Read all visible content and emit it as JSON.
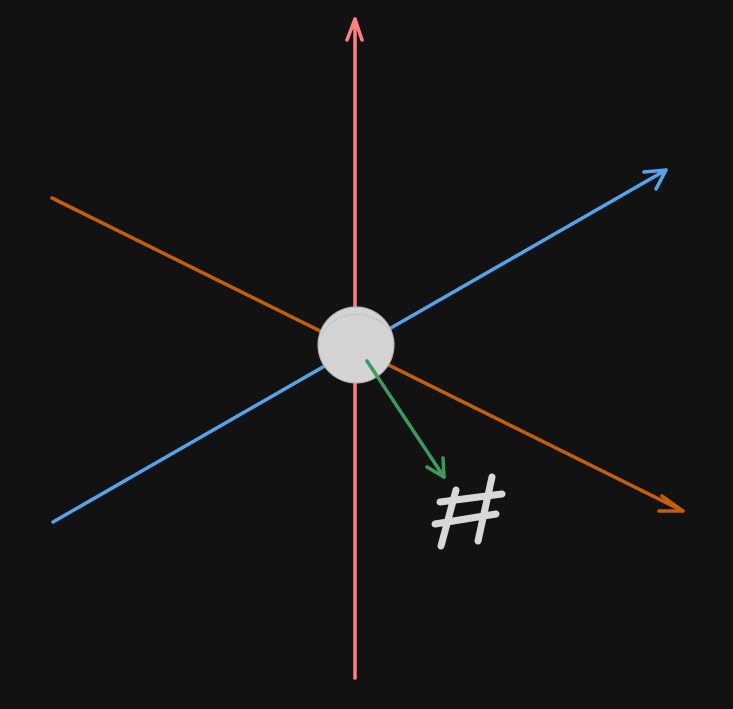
{
  "diagram": {
    "background_color": "#121212",
    "axes": [
      {
        "name": "vertical-axis",
        "color": "#ff8080",
        "has_arrowhead": true
      },
      {
        "name": "diagonal-axis-up-right",
        "color": "#55a3eb",
        "has_arrowhead": true
      },
      {
        "name": "diagonal-axis-down-right",
        "color": "#c45f0b",
        "has_arrowhead": true
      }
    ],
    "origin": {
      "fill_color": "#d4d4d4",
      "stroke_color": "#b0b0b0"
    },
    "vector": {
      "color": "#3d9a5c",
      "has_arrowhead": true
    },
    "label": {
      "text": "#",
      "color": "#d8d8d8"
    }
  }
}
